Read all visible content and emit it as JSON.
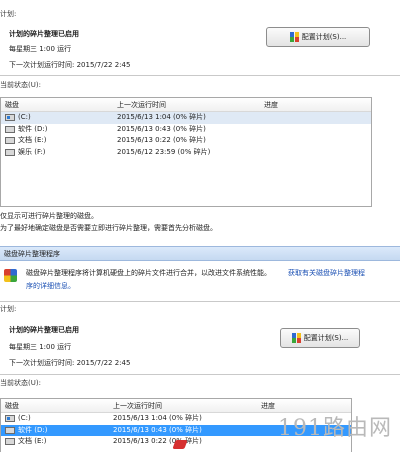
{
  "window_title": "磁盘碎片整理程序",
  "description": "磁盘碎片整理程序将计算机硬盘上的碎片文件进行合并，以改进文件系统性能。",
  "help_link": "获取有关磁盘碎片整理程序的详细信息。",
  "schedule_label": "计划:",
  "schedule_status": "计划的碎片整理已启用",
  "schedule_runs": "每星期三 1:00 运行",
  "next_run_top": "下一次计划运行时间: 2015/7/22 2:45",
  "next_run_bottom": "下一次计划运行时间: 2015/7/22 2:45",
  "configure_button": "配置计划(S)...",
  "current_status": "当前状态(U):",
  "columns": {
    "disk": "磁盘",
    "last_run": "上一次运行时间",
    "progress": "进度"
  },
  "disks_top": [
    {
      "name": "(C:)",
      "last": "2015/6/13 1:04 (0% 碎片)",
      "icon": "system-drive-icon"
    },
    {
      "name": "软件 (D:)",
      "last": "2015/6/13 0:43 (0% 碎片)",
      "icon": "drive-icon"
    },
    {
      "name": "文档 (E:)",
      "last": "2015/6/13 0:22 (0% 碎片)",
      "icon": "drive-icon"
    },
    {
      "name": "娱乐 (F:)",
      "last": "2015/6/12 23:59 (0% 碎片)",
      "icon": "drive-icon"
    }
  ],
  "disks_bottom": [
    {
      "name": "(C:)",
      "last": "2015/6/13 1:04 (0% 碎片)"
    },
    {
      "name": "软件 (D:)",
      "last": "2015/6/13 0:43 (0% 碎片)"
    },
    {
      "name": "文档 (E:)",
      "last": "2015/6/13 0:22 (0% 碎片)"
    }
  ],
  "note_1": "仅显示可进行碎片整理的磁盘。",
  "note_2": "为了最好地确定磁盘是否需要立即进行碎片整理，需要首先分析磁盘。",
  "watermark": "191路由网"
}
